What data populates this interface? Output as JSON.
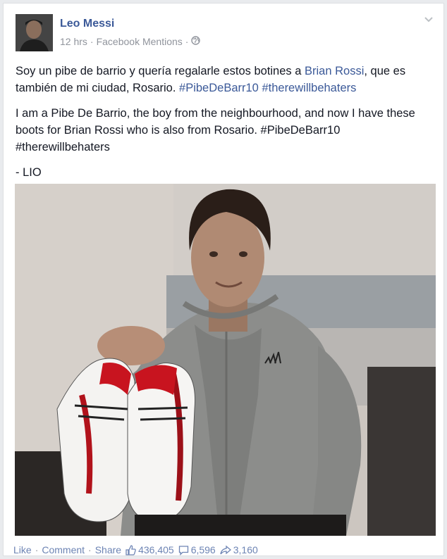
{
  "post": {
    "author": "Leo Messi",
    "time": "12 hrs",
    "separator": "·",
    "source": "Facebook Mentions",
    "spanish": {
      "t1": "Soy un pibe de barrio y quería regalarle estos botines a ",
      "mention": "Brian Rossi",
      "t2": ", que es también de mi ciudad, Rosario. ",
      "tag1": "#PibeDeBarr10",
      "t3": " ",
      "tag2": "#therewillbehaters"
    },
    "english": "I am a Pibe De Barrio, the boy from the neighbourhood, and now I have these boots for Brian Rossi who is also from Rosario. #PibeDeBarr10 #therewillbehaters",
    "signoff": "- LIO"
  },
  "footer": {
    "like": "Like",
    "comment": "Comment",
    "share": "Share",
    "dot": "·",
    "likes_count": "436,405",
    "comments_count": "6,596",
    "shares_count": "3,160"
  },
  "icons": {
    "globe": "globe-icon",
    "chevron": "chevron-down-icon",
    "thumb": "thumbs-up-icon",
    "comment": "comment-bubble-icon",
    "share": "share-arrow-icon"
  },
  "colors": {
    "link": "#3b5998",
    "meta": "#90949c",
    "footer_link": "#6d84b4"
  }
}
